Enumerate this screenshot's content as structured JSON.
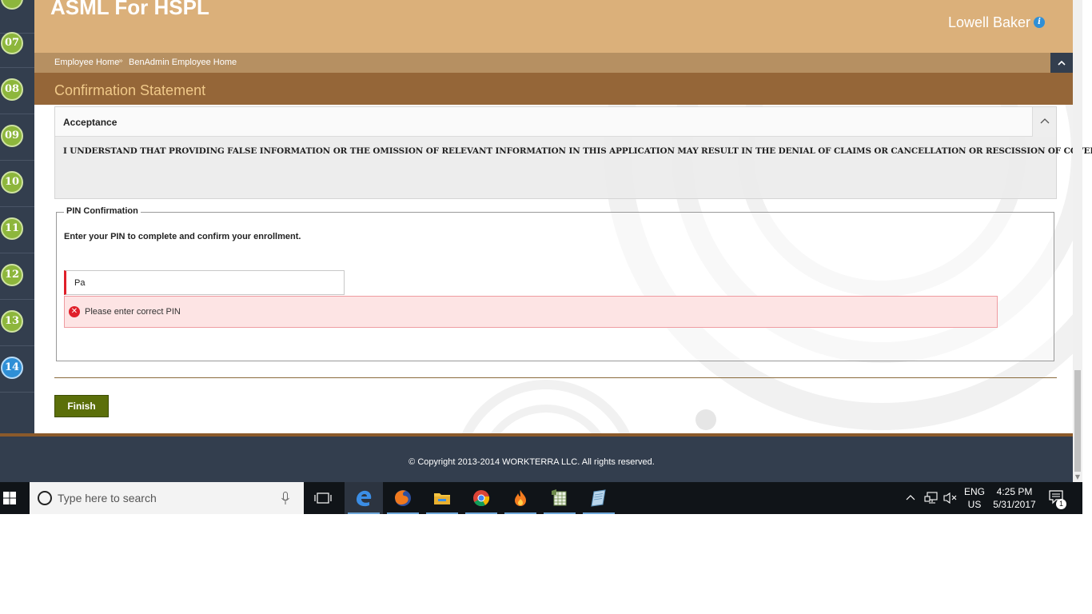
{
  "header": {
    "app_title": "ASML For HSPL",
    "user_name": "Lowell Baker"
  },
  "breadcrumb": {
    "items": [
      "Employee Home",
      "BenAdmin Employee Home"
    ]
  },
  "page_title": "Confirmation Statement",
  "steps": [
    {
      "number": "07",
      "current": false
    },
    {
      "number": "08",
      "current": false
    },
    {
      "number": "09",
      "current": false
    },
    {
      "number": "10",
      "current": false
    },
    {
      "number": "11",
      "current": false
    },
    {
      "number": "12",
      "current": false
    },
    {
      "number": "13",
      "current": false
    },
    {
      "number": "14",
      "current": true
    }
  ],
  "acceptance": {
    "title": "Acceptance",
    "statement": "I UNDERSTAND THAT PROVIDING FALSE INFORMATION OR THE OMISSION OF RELEVANT INFORMATION IN THIS APPLICATION MAY RESULT IN THE DENIAL OF CLAIMS OR CANCELLATION OR RESCISSION OF COVERAGE."
  },
  "pin": {
    "legend": "PIN Confirmation",
    "instruction": "Enter your PIN to complete and confirm your enrollment.",
    "value": "Pa",
    "error": "Please enter correct PIN"
  },
  "finish_label": "Finish",
  "footer": {
    "copyright": "© Copyright 2013-2014 WORKTERRA LLC. All rights reserved."
  },
  "taskbar": {
    "search_placeholder": "Type here to search",
    "lang_top": "ENG",
    "lang_bottom": "US",
    "time": "4:25 PM",
    "date": "5/31/2017",
    "notification_count": "1"
  },
  "colors": {
    "header_bg": "#dbb07a",
    "title_bar_bg": "#956638",
    "sidebar_bg": "#333e4e",
    "step_green": "#8db63c",
    "step_current_blue": "#2f8fd6",
    "finish_green": "#5b6f0a",
    "error_red": "#e0202a"
  }
}
